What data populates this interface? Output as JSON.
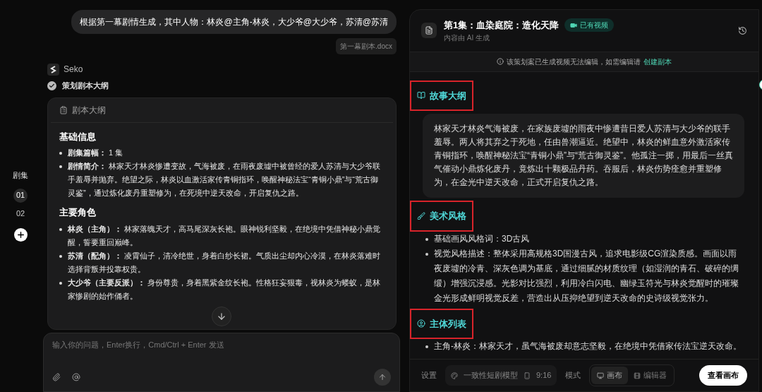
{
  "sidebar": {
    "title": "剧集",
    "episodes": [
      {
        "label": "01",
        "selected": true
      },
      {
        "label": "02",
        "selected": false
      }
    ]
  },
  "chat": {
    "user_message": "根据第一幕剧情生成，其中人物：林炎@主角-林炎，大少爷@大少爷，苏清@苏清",
    "attachment": "第一幕剧本.docx",
    "assistant_name": "Seko",
    "step": {
      "label": "策划剧本大纲",
      "done": true
    },
    "outline_card": {
      "title": "剧本大纲",
      "sections": [
        {
          "heading": "基础信息",
          "items": [
            {
              "label": "剧集篇幅：",
              "text": "1 集"
            },
            {
              "label": "剧情简介：",
              "text": "林家天才林炎惨遭变故，气海被废，在雨夜废墟中被曾经的爱人苏清与大少爷联手羞辱并抛弃。绝望之际，林炎以血激活家传青铜指环，唤醒神秘法宝“青铜小鼎”与“荒古御灵鉴”，通过炼化废丹重塑修为，在死境中逆天改命，开启复仇之路。"
            }
          ]
        },
        {
          "heading": "主要角色",
          "items": [
            {
              "label": "林炎（主角）：",
              "text": "林家落魄天才，高马尾深灰长袍。眼神锐利坚毅，在绝境中凭借神秘小鼎觉醒，誓要重回巅峰。"
            },
            {
              "label": "苏清（配角）：",
              "text": "凌霄仙子，清冷绝世，身着白纱长裙。气质出尘却内心冷漠，在林炎落难时选择背叛并投靠权贵。"
            },
            {
              "label": "大少爷（主要反派）：",
              "text": "身份尊贵，身着黑紫金纹长袍。性格狂妄狠毒，视林炎为蝼蚁，是林家惨剧的始作俑者。"
            }
          ]
        }
      ]
    },
    "input": {
      "placeholder": "输入你的问题，Enter换行，Cmd/Ctrl + Enter 发送"
    }
  },
  "panel": {
    "title": "第1集：血染庭院：造化天降",
    "badge": "已有视频",
    "subtitle": "内容由 AI 生成",
    "notice": {
      "text": "该策划案已生成视频无法编辑，如需编辑请",
      "link": "创建副本"
    },
    "sections": [
      {
        "kind": "paragraph",
        "heading": "故事大纲",
        "highlighted": true,
        "text": "林家天才林炎气海被废，在家族废墟的雨夜中惨遭昔日爱人苏清与大少爷的联手羞辱。两人将其弃之于死地，任由兽潮逼近。绝望中，林炎的鲜血意外激活家传青铜指环，唤醒神秘法宝“青铜小鼎”与“荒古御灵鉴”。他孤注一掷，用最后一丝真气催动小鼎炼化废丹，竟炼出十颗极品丹药。吞服后，林炎伤势痊愈并重塑修为，在金光中逆天改命，正式开启复仇之路。"
      },
      {
        "kind": "list",
        "heading": "美术风格",
        "highlighted": true,
        "items": [
          "基础画风风格词：3D古风",
          "视觉风格描述：整体采用高规格3D国漫古风，追求电影级CG渲染质感。画面以雨夜废墟的冷青、深灰色调为基底，通过细腻的材质纹理（如湿润的青石、破碎的绸缎）增强沉浸感。光影对比强烈，利用冷白闪电、幽绿玉符光与林炎觉醒时的璀璨金光形成鲜明视觉反差，营造出从压抑绝望到逆天改命的史诗级视觉张力。"
        ]
      },
      {
        "kind": "list",
        "heading": "主体列表",
        "highlighted": true,
        "items": [
          "主角-林炎：林家天才，虽气海被废却意志坚毅，在绝境中凭借家传法宝逆天改命。"
        ]
      }
    ],
    "toolbar": {
      "settings_label": "设置",
      "model": "一致性短剧模型",
      "ratio": "9:16",
      "mode_label": "模式",
      "modes": [
        {
          "label": "画布",
          "selected": true
        },
        {
          "label": "编辑器",
          "selected": false
        }
      ],
      "primary_button": "查看画布"
    }
  }
}
